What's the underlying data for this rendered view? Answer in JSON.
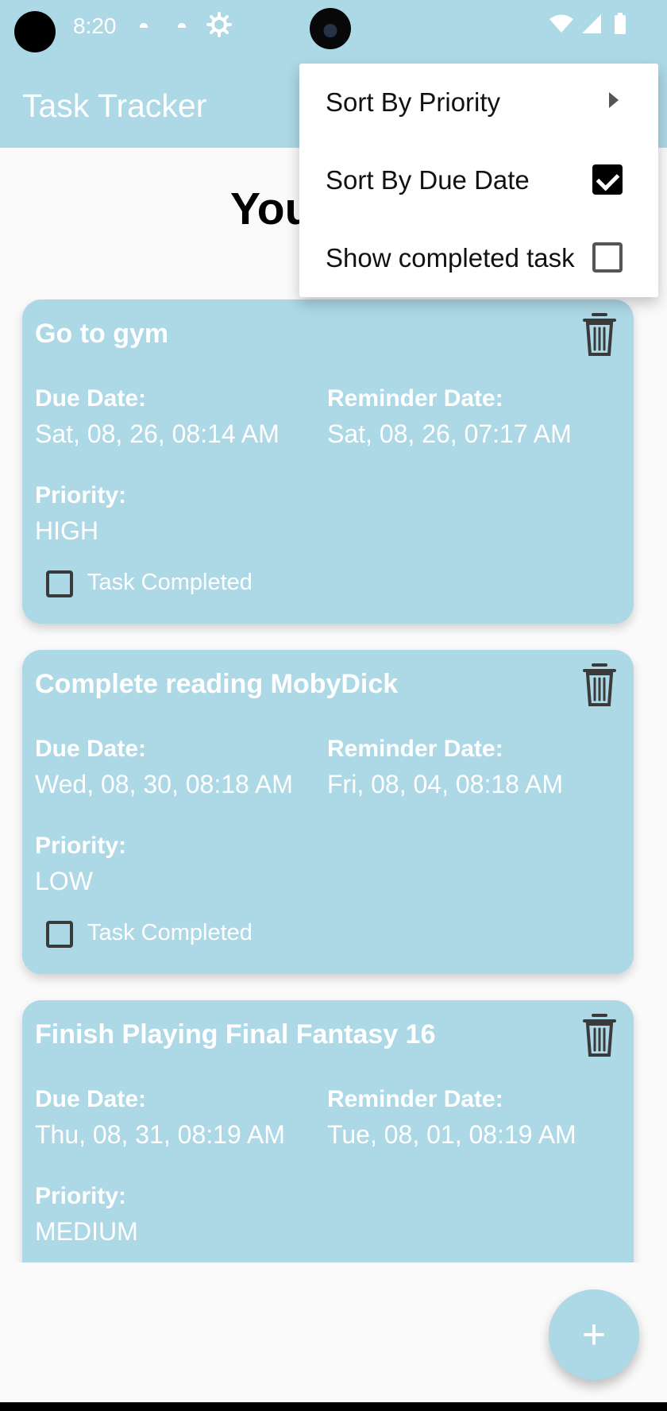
{
  "status_bar": {
    "time": "8:20"
  },
  "app": {
    "title": "Task Tracker"
  },
  "page": {
    "heading_visible": "You"
  },
  "menu": {
    "items": [
      {
        "label": "Sort By Priority",
        "control": "submenu-arrow"
      },
      {
        "label": "Sort By Due Date",
        "checked": true
      },
      {
        "label": "Show completed task",
        "checked": false
      }
    ]
  },
  "labels": {
    "due_date": "Due Date:",
    "reminder_date": "Reminder Date:",
    "priority": "Priority:",
    "task_completed": "Task Completed"
  },
  "tasks": [
    {
      "title": "Go to gym",
      "due_date": "Sat, 08, 26, 08:14 AM",
      "reminder_date": "Sat, 08, 26, 07:17 AM",
      "priority": "HIGH",
      "completed": false
    },
    {
      "title": "Complete reading MobyDick",
      "due_date": "Wed, 08, 30, 08:18 AM",
      "reminder_date": "Fri, 08, 04, 08:18 AM",
      "priority": "LOW",
      "completed": false
    },
    {
      "title": "Finish Playing Final Fantasy 16",
      "due_date": "Thu, 08, 31, 08:19 AM",
      "reminder_date": "Tue, 08, 01, 08:19 AM",
      "priority": "MEDIUM"
    }
  ],
  "fab": {
    "label": "+"
  },
  "colors": {
    "accent": "#add8e6",
    "background": "#fafafa",
    "text_on_accent": "#ffffff"
  },
  "icons": {
    "delete": "trash-icon",
    "add": "plus-icon",
    "submenu": "chevron-right-icon",
    "wifi": "wifi-icon",
    "signal": "signal-icon",
    "battery": "battery-icon",
    "settings": "gear-icon"
  }
}
